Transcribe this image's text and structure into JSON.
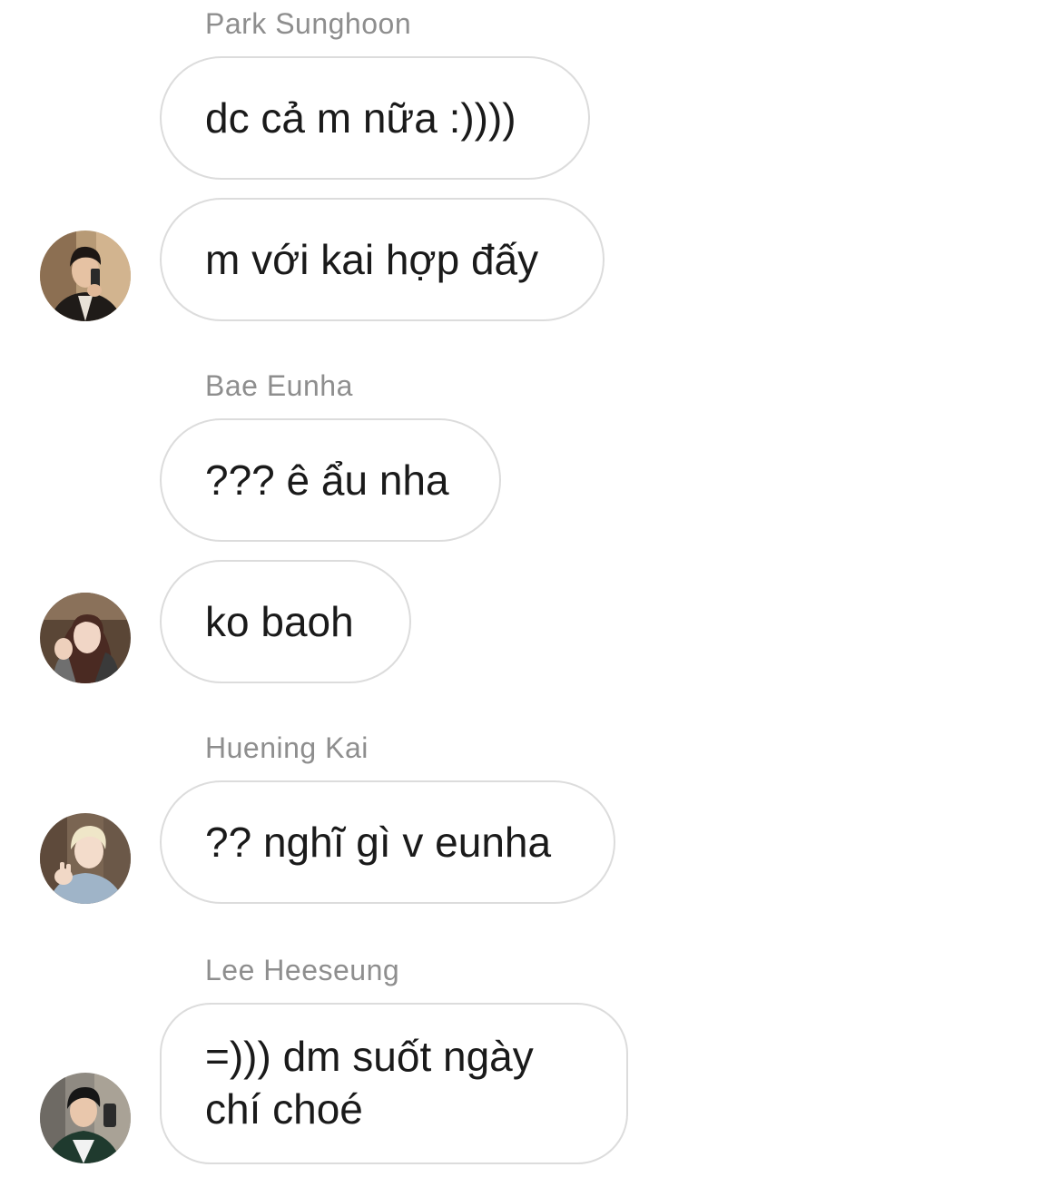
{
  "messages": [
    {
      "sender": "Park Sunghoon",
      "avatar_icon": "profile-photo-avatar",
      "lines": [
        "dc cả m nữa :))))",
        "m với kai hợp đấy"
      ]
    },
    {
      "sender": "Bae Eunha",
      "avatar_icon": "profile-photo-avatar",
      "lines": [
        "??? ê ẩu nha",
        "ko baoh"
      ]
    },
    {
      "sender": "Huening Kai",
      "avatar_icon": "profile-photo-avatar",
      "lines": [
        "?? nghĩ gì v eunha"
      ]
    },
    {
      "sender": "Lee Heeseung",
      "avatar_icon": "profile-photo-avatar",
      "lines": [
        "=))) dm suốt ngày chí choé"
      ]
    }
  ],
  "colors": {
    "background": "#ffffff",
    "bubble_border": "#dcdcdc",
    "sender_text": "#8e8e8e",
    "message_text": "#1a1a1a"
  }
}
